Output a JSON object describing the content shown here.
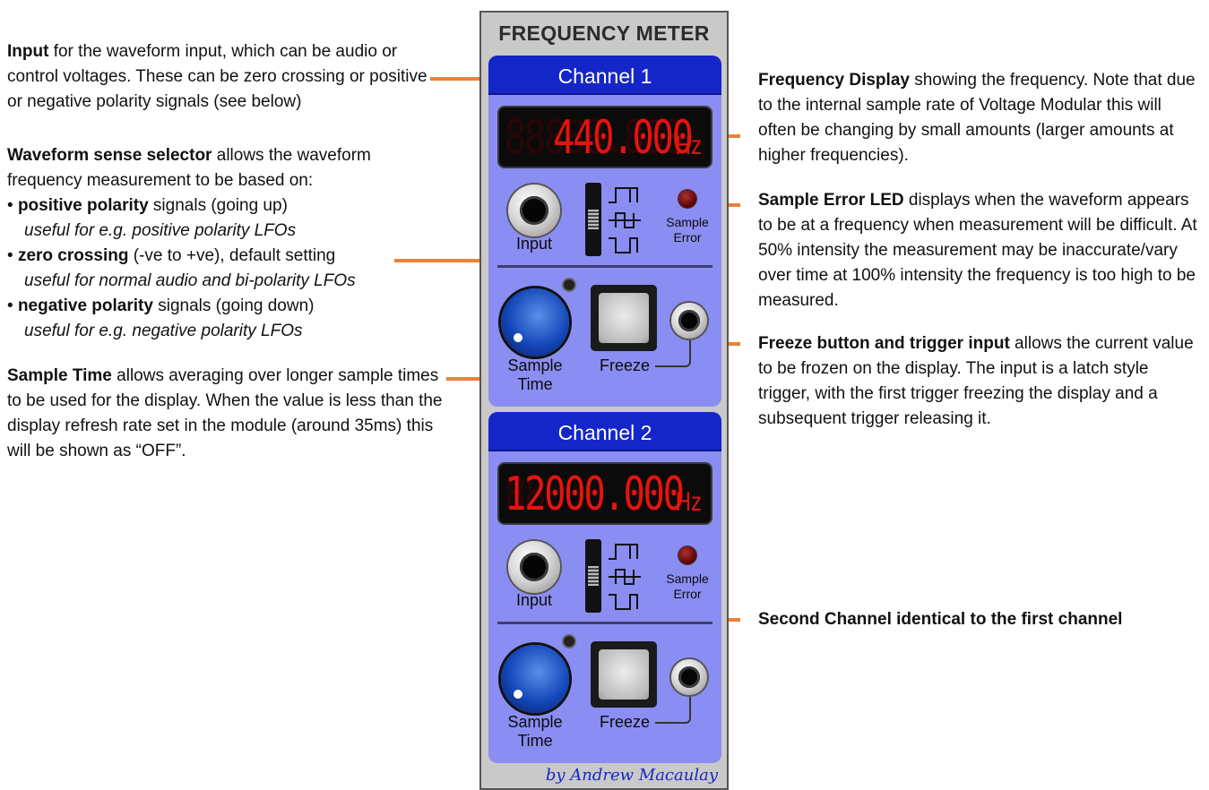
{
  "annotations": {
    "input": {
      "bold": "Input",
      "text": " for the waveform input, which can be audio or control voltages. These can be zero crossing or positive or negative polarity signals (see below)"
    },
    "waveform": {
      "bold": "Waveform sense selector",
      "text": " allows the waveform frequency measurement to be based on:",
      "bullets": [
        {
          "bold": "positive polarity",
          "text": " signals (going up)",
          "italic": "useful for e.g. positive polarity LFOs"
        },
        {
          "bold": "zero crossing",
          "text": " (-ve to +ve), default setting",
          "italic": "useful for normal audio and bi-polarity LFOs"
        },
        {
          "bold": "negative polarity",
          "text": " signals (going down)",
          "italic": "useful for e.g. negative polarity LFOs"
        }
      ]
    },
    "sample_time": {
      "bold": "Sample Time",
      "text": " allows averaging over longer sample times to be used for the display. When the value is less than the display refresh rate set in the module (around 35ms) this will be shown as “OFF”."
    },
    "freq_display": {
      "bold": "Frequency Display",
      "text": " showing the frequency. Note that due to the internal sample rate of Voltage Modular this will often be changing by small amounts (larger amounts at higher frequencies)."
    },
    "sample_error": {
      "bold": "Sample Error LED",
      "text": " displays when the waveform appears to be at a frequency when measurement will be difficult. At 50% intensity the measurement may be inaccurate/vary over time at 100% intensity the frequency is too high to be measured."
    },
    "freeze": {
      "bold": "Freeze button and trigger input",
      "text": " allows the current value to be frozen on the display. The input is a latch style trigger, with the first trigger freezing the display and a subsequent trigger releasing it."
    },
    "second_channel": {
      "bold": "Second Channel identical to the first channel"
    }
  },
  "module": {
    "title": "FREQUENCY METER",
    "signature": "by Andrew Macaulay",
    "channels": [
      {
        "header": "Channel 1",
        "digits": "440.000",
        "ghost": "88888.888",
        "unit": "Hz",
        "input_label": "Input",
        "sample_label": "Sample",
        "error_label": "Error",
        "sample_time_label_1": "Sample",
        "sample_time_label_2": "Time",
        "freeze_label": "Freeze"
      },
      {
        "header": "Channel 2",
        "digits": "12000.000",
        "ghost": "88888.888",
        "unit": "Hz",
        "input_label": "Input",
        "sample_label": "Sample",
        "error_label": "Error",
        "sample_time_label_1": "Sample",
        "sample_time_label_2": "Time",
        "freeze_label": "Freeze"
      }
    ]
  },
  "colors": {
    "arrow": "#e8823a",
    "panel": "#8a8ef2",
    "header": "#1526c8",
    "segment": "#e3140f"
  }
}
